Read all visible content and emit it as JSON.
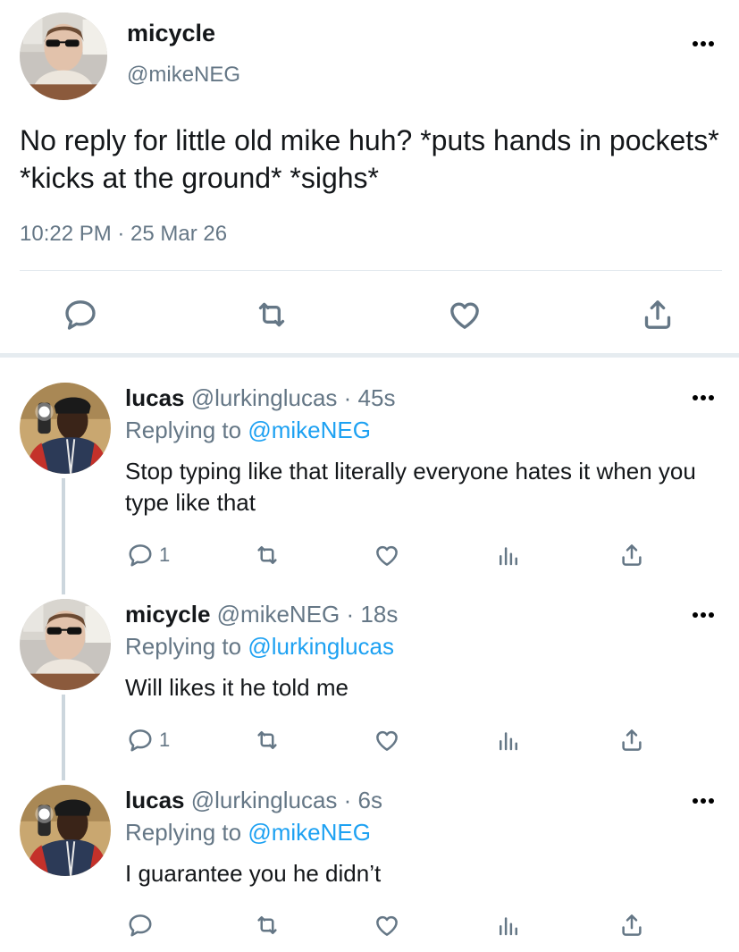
{
  "main_tweet": {
    "name": "micycle",
    "handle": "@mikeNEG",
    "text": "No reply for little old mike huh? *puts hands in pockets* *kicks at the ground* *sighs*",
    "timestamp": "10:22 PM · 25 Mar 26",
    "actions": [
      "reply-icon",
      "retweet-icon",
      "like-icon",
      "share-icon"
    ]
  },
  "replies": [
    {
      "name": "lucas",
      "handle": "@lurkinglucas",
      "age": "· 45s",
      "replying_prefix": "Replying to ",
      "replying_to": "@mikeNEG",
      "text": "Stop typing like that literally everyone hates it when you type like that",
      "reply_count": "1"
    },
    {
      "name": "micycle",
      "handle": "@mikeNEG",
      "age": "· 18s",
      "replying_prefix": "Replying to ",
      "replying_to": "@lurkinglucas",
      "text": "Will likes it he told me",
      "reply_count": "1"
    },
    {
      "name": "lucas",
      "handle": "@lurkinglucas",
      "age": "· 6s",
      "replying_prefix": "Replying to ",
      "replying_to": "@mikeNEG",
      "text": "I guarantee you he didn’t",
      "reply_count": ""
    }
  ],
  "colors": {
    "text": "#14171a",
    "secondary": "#657786",
    "accent": "#1da1f2",
    "divider": "#e1e8ed"
  }
}
